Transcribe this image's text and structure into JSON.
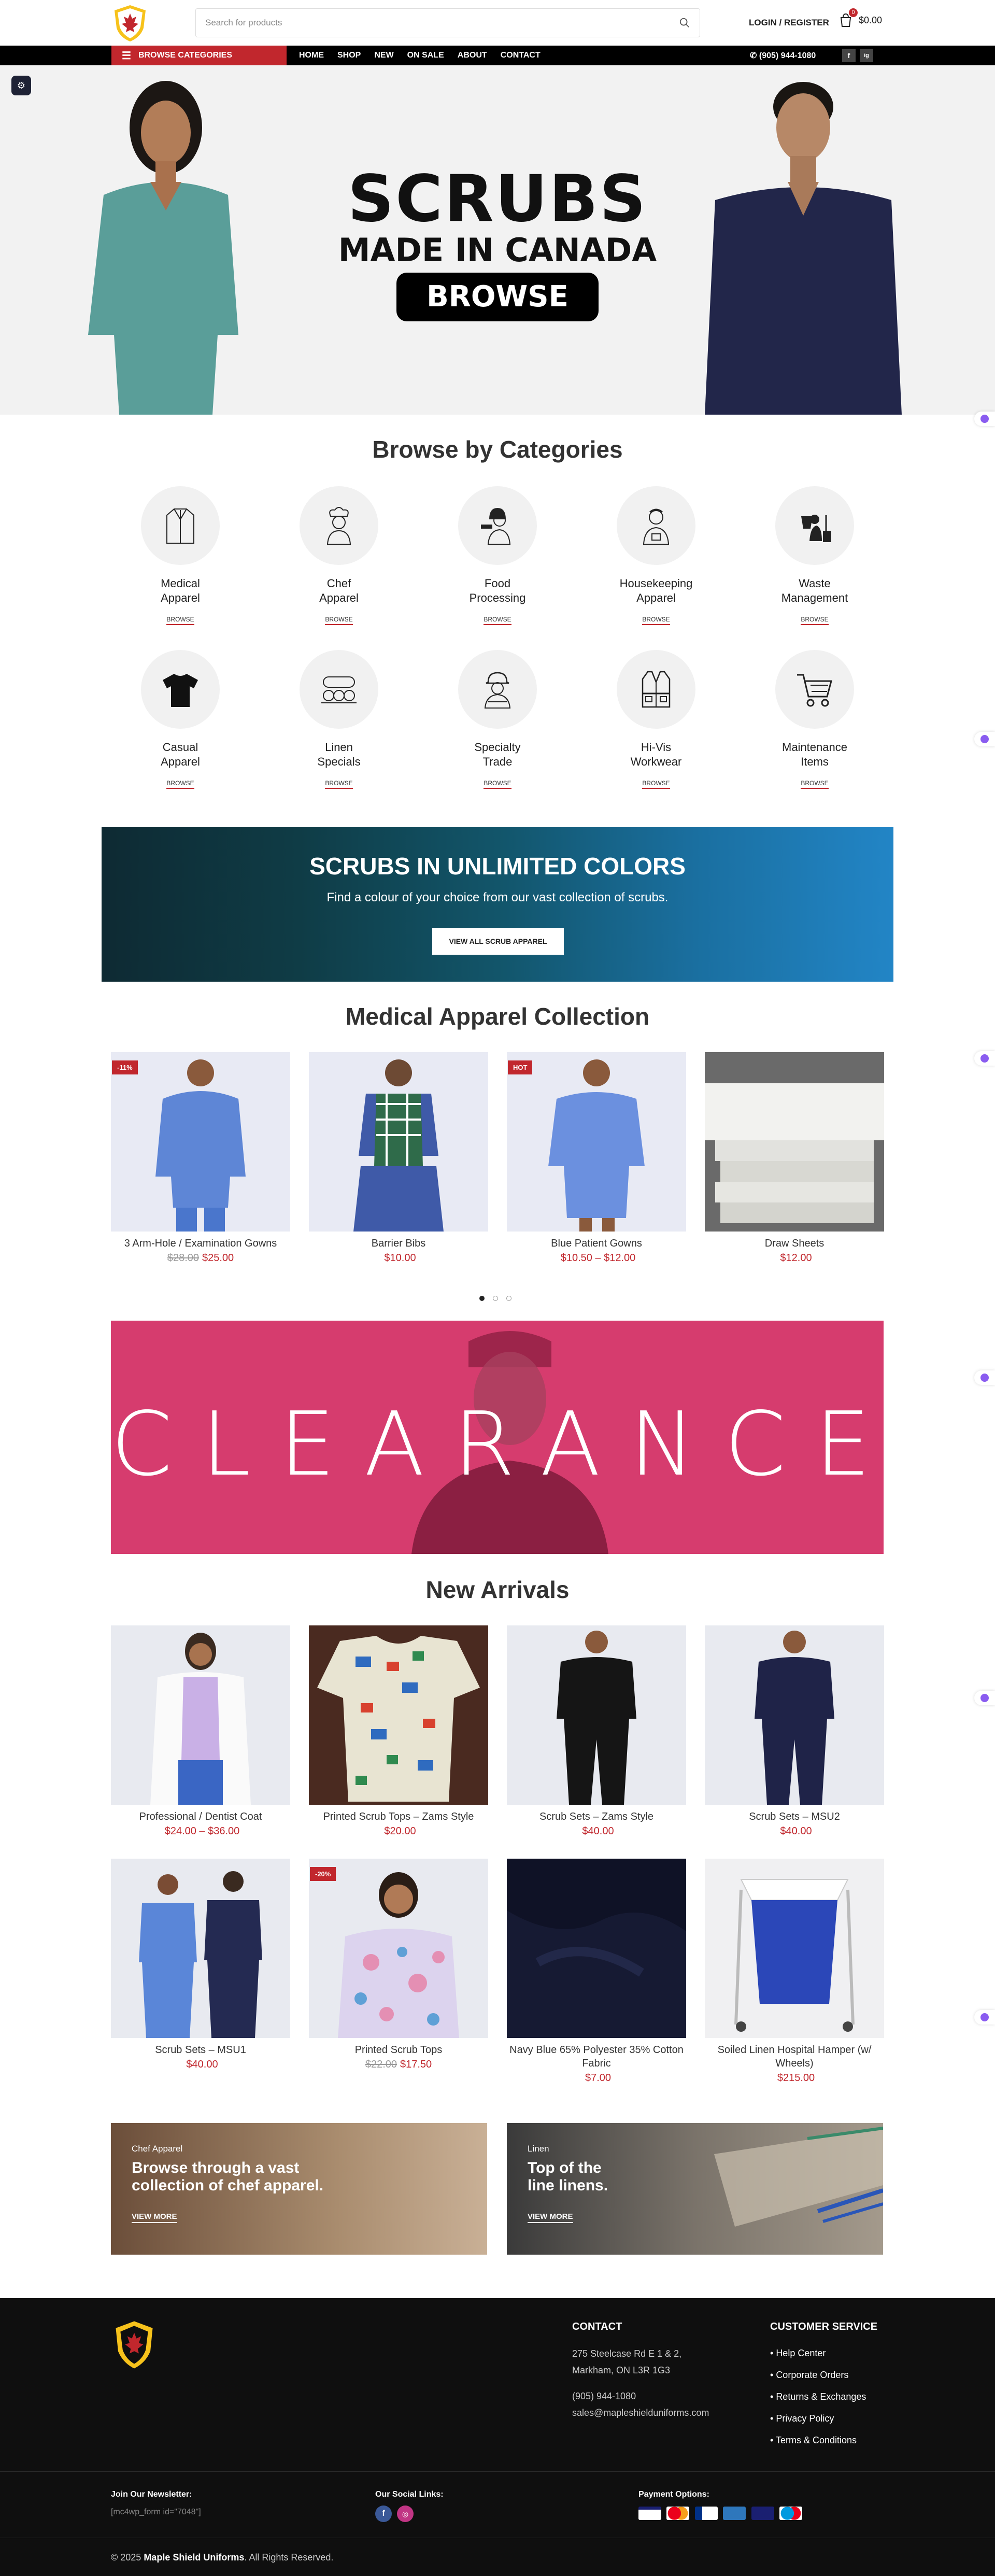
{
  "header": {
    "search_placeholder": "Search for products",
    "login": "LOGIN / REGISTER",
    "cart_count": "0",
    "cart_total": "$0.00",
    "browse_categories": "BROWSE CATEGORIES",
    "menu": [
      "HOME",
      "SHOP",
      "NEW",
      "ON SALE",
      "ABOUT",
      "CONTACT"
    ],
    "phone": "(905) 944-1080",
    "social": [
      "f",
      "ig"
    ]
  },
  "hero": {
    "title": "SCRUBS",
    "subtitle": "MADE IN CANADA",
    "button": "BROWSE"
  },
  "categories": {
    "title": "Browse by Categories",
    "browse_label": "BROWSE",
    "items": [
      {
        "name": "Medical\nApparel",
        "icon": "lab-coat-icon"
      },
      {
        "name": "Chef\nApparel",
        "icon": "chef-icon"
      },
      {
        "name": "Food\nProcessing",
        "icon": "food-worker-icon"
      },
      {
        "name": "Housekeeping\nApparel",
        "icon": "housekeeper-icon"
      },
      {
        "name": "Waste\nManagement",
        "icon": "waste-icon"
      },
      {
        "name": "Casual\nApparel",
        "icon": "tshirt-icon"
      },
      {
        "name": "Linen\nSpecials",
        "icon": "linen-icon"
      },
      {
        "name": "Specialty\nTrade",
        "icon": "hardhat-worker-icon"
      },
      {
        "name": "Hi-Vis\nWorkwear",
        "icon": "vest-icon"
      },
      {
        "name": "Maintenance\nItems",
        "icon": "cart-icon"
      }
    ]
  },
  "colors_banner": {
    "title": "SCRUBS IN UNLIMITED COLORS",
    "text": "Find a colour of your choice from our vast collection of scrubs.",
    "button": "VIEW ALL SCRUB APPAREL"
  },
  "medical": {
    "title": "Medical Apparel Collection",
    "products": [
      {
        "name": "3 Arm-Hole / Examination Gowns",
        "old": "$28.00",
        "price": "$25.00",
        "badge": "-11%"
      },
      {
        "name": "Barrier Bibs",
        "old": "",
        "price": "$10.00",
        "badge": ""
      },
      {
        "name": "Blue Patient Gowns",
        "old": "",
        "price": "$10.50 – $12.00",
        "badge": "HOT"
      },
      {
        "name": "Draw Sheets",
        "old": "",
        "price": "$12.00",
        "badge": ""
      }
    ]
  },
  "clearance": {
    "text": "CLEARANCE"
  },
  "arrivals": {
    "title": "New Arrivals",
    "products": [
      {
        "name": "Professional / Dentist Coat",
        "old": "",
        "price": "$24.00 – $36.00",
        "badge": ""
      },
      {
        "name": "Printed Scrub Tops – Zams Style",
        "old": "",
        "price": "$20.00",
        "badge": ""
      },
      {
        "name": "Scrub Sets – Zams Style",
        "old": "",
        "price": "$40.00",
        "badge": ""
      },
      {
        "name": "Scrub Sets – MSU2",
        "old": "",
        "price": "$40.00",
        "badge": ""
      },
      {
        "name": "Scrub Sets – MSU1",
        "old": "",
        "price": "$40.00",
        "badge": ""
      },
      {
        "name": "Printed Scrub Tops",
        "old": "$22.00",
        "price": "$17.50",
        "badge": "-20%"
      },
      {
        "name": "Navy Blue 65% Polyester 35% Cotton Fabric",
        "old": "",
        "price": "$7.00",
        "badge": ""
      },
      {
        "name": "Soiled Linen Hospital Hamper (w/ Wheels)",
        "old": "",
        "price": "$215.00",
        "badge": ""
      }
    ]
  },
  "promos": [
    {
      "tag": "Chef Apparel",
      "headline": "Browse through a vast collection of chef apparel.",
      "button": "VIEW MORE"
    },
    {
      "tag": "Linen",
      "headline": "Top of the line linens.",
      "button": "VIEW MORE"
    }
  ],
  "footer": {
    "contact_title": "CONTACT",
    "address1": "275 Steelcase Rd E 1 & 2,",
    "address2": "Markham, ON L3R 1G3",
    "phone": "(905) 944-1080",
    "email": "sales@mapleshielduniforms.com",
    "service_title": "CUSTOMER SERVICE",
    "service_links": [
      "Help Center",
      "Corporate Orders",
      "Returns & Exchanges",
      "Privacy Policy",
      "Terms & Conditions"
    ],
    "newsletter_title": "Join Our Newsletter:",
    "newsletter_text": "[mc4wp_form id=\"7048\"]",
    "social_title": "Our Social Links:",
    "payment_title": "Payment Options:",
    "copyright_prefix": "© 2025 ",
    "copyright_brand": "Maple Shield Uniforms",
    "copyright_suffix": ". All Rights Reserved."
  },
  "colors": {
    "accent": "#c1272d",
    "clearance": "#d63c6e",
    "dark": "#0f0f0f"
  }
}
